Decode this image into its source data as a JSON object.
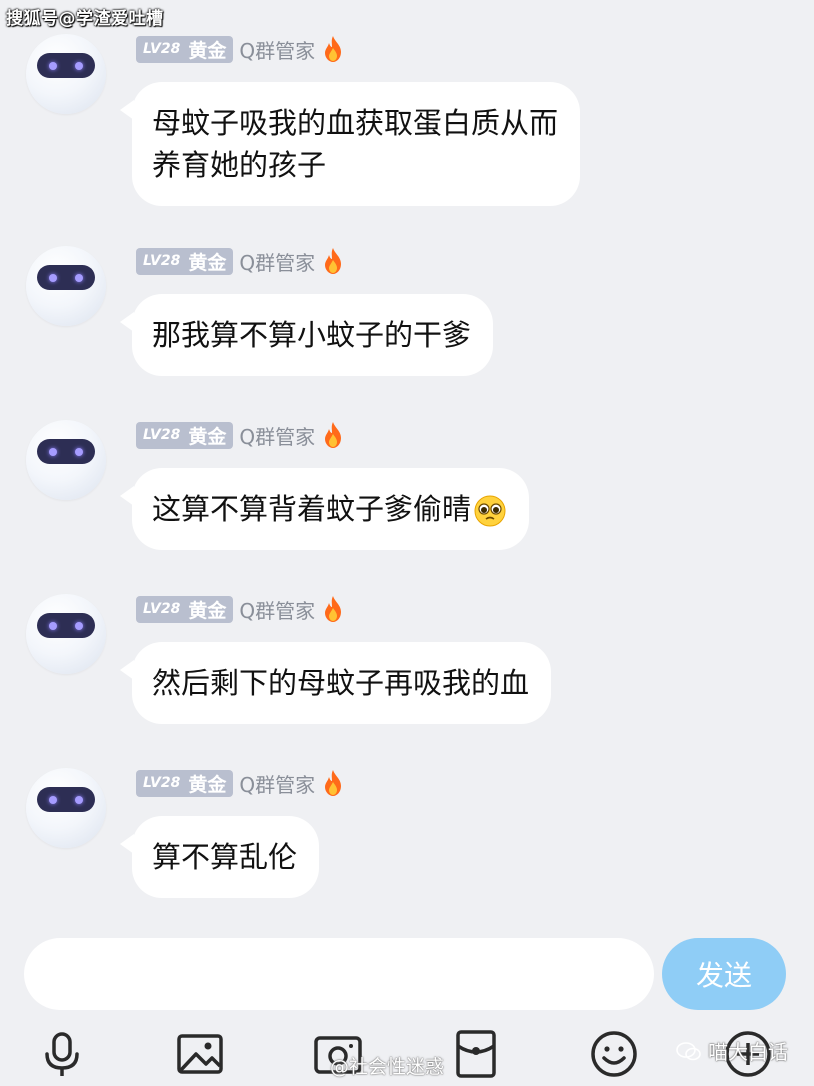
{
  "watermarks": {
    "top": "搜狐号@学渣爱吐槽",
    "bottom_center": "@社会性迷惑",
    "bottom_right": "喵大白话"
  },
  "sender": {
    "level": "LV28",
    "rank": "黄金",
    "role": "Q群管家"
  },
  "messages": [
    {
      "lines": [
        "母蚊子吸我的血获取蛋白质从而",
        "养育她的孩子"
      ]
    },
    {
      "lines": [
        "那我算不算小蚊子的干爹"
      ]
    },
    {
      "lines": [
        "这算不算背着蚊子爹偷晴"
      ],
      "emoji": "pleading-face"
    },
    {
      "lines": [
        "然后剩下的母蚊子再吸我的血"
      ]
    },
    {
      "lines": [
        "算不算乱伦"
      ]
    }
  ],
  "input": {
    "value": "",
    "placeholder": "",
    "send_label": "发送"
  },
  "toolbar": {
    "icons": [
      "microphone-icon",
      "image-icon",
      "camera-icon",
      "red-packet-icon",
      "emoji-icon",
      "plus-icon"
    ]
  },
  "colors": {
    "background": "#eff0f3",
    "bubble": "#ffffff",
    "send_button": "#8fcdf6",
    "badge": "#b9bfcf",
    "role_text": "#8a8f99"
  }
}
